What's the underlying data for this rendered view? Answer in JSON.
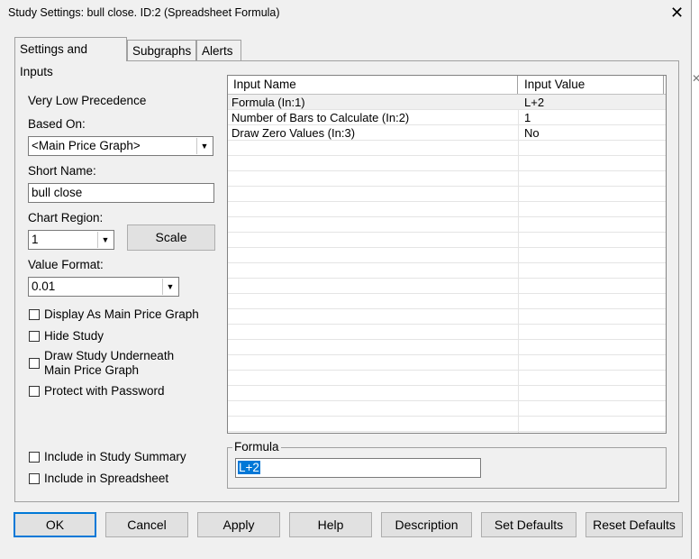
{
  "window": {
    "title": "Study Settings: bull close. ID:2 (Spreadsheet Formula)",
    "close_glyph": "✕"
  },
  "tabs": [
    {
      "label": "Settings and Inputs",
      "active": true
    },
    {
      "label": "Subgraphs",
      "active": false
    },
    {
      "label": "Alerts",
      "active": false
    }
  ],
  "left": {
    "precedence": "Very Low Precedence",
    "based_on": {
      "label": "Based On:",
      "value": "<Main Price Graph>"
    },
    "short_name": {
      "label": "Short Name:",
      "value": "bull close"
    },
    "chart_region": {
      "label": "Chart Region:",
      "value": "1"
    },
    "scale_button": "Scale",
    "value_format": {
      "label": "Value Format:",
      "value": "0.01"
    },
    "checkboxes": [
      {
        "label": "Display As Main Price Graph",
        "checked": false
      },
      {
        "label": "Hide Study",
        "checked": false
      },
      {
        "label_line1": "Draw Study Underneath",
        "label_line2": "Main Price Graph",
        "checked": false
      },
      {
        "label": "Protect with Password",
        "checked": false
      },
      {
        "label": "Include in Study Summary",
        "checked": false
      },
      {
        "label": "Include in Spreadsheet",
        "checked": false
      }
    ]
  },
  "inputs_grid": {
    "columns": [
      "Input Name",
      "Input Value"
    ],
    "rows": [
      {
        "name": "Formula   (In:1)",
        "value": "L+2"
      },
      {
        "name": "Number of Bars to Calculate   (In:2)",
        "value": "1"
      },
      {
        "name": "Draw Zero Values   (In:3)",
        "value": "No"
      }
    ]
  },
  "formula": {
    "label": "Formula",
    "value": "L+2"
  },
  "buttons": {
    "ok": "OK",
    "cancel": "Cancel",
    "apply": "Apply",
    "help": "Help",
    "description": "Description",
    "set_defaults": "Set Defaults",
    "reset_defaults": "Reset Defaults"
  },
  "icons": {
    "dropdown": "chevron-down-icon",
    "close": "close-icon"
  },
  "colors": {
    "accent": "#0078d7",
    "background": "#f0f0f0"
  }
}
